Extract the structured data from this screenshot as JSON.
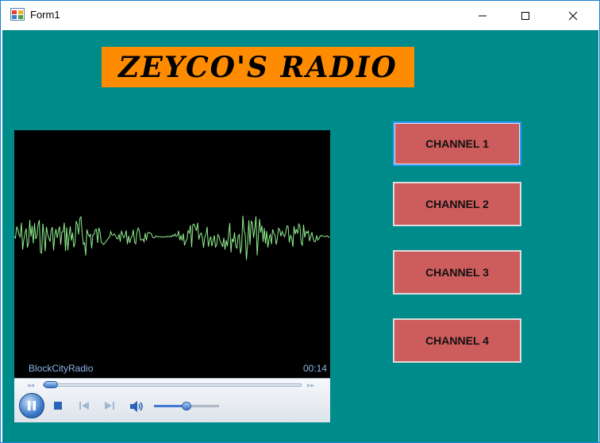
{
  "window": {
    "title": "Form1",
    "icon": "windows-form-icon",
    "buttons": [
      "minimize-icon",
      "maximize-icon",
      "close-icon"
    ]
  },
  "logo": {
    "text": "ZEYCO'S RADIO"
  },
  "player": {
    "station_name": "BlockCityRadio",
    "time": "00:14",
    "seek_progress": 0.02,
    "volume_level": 0.5,
    "visualizer_color": "#90ee90"
  },
  "channels": [
    {
      "label": "CHANNEL 1"
    },
    {
      "label": "CHANNEL 2"
    },
    {
      "label": "CHANNEL 3"
    },
    {
      "label": "CHANNEL 4"
    }
  ],
  "colors": {
    "background": "#008b8b",
    "logo_bg": "#ff8c00",
    "button_bg": "#cd5c5c"
  }
}
